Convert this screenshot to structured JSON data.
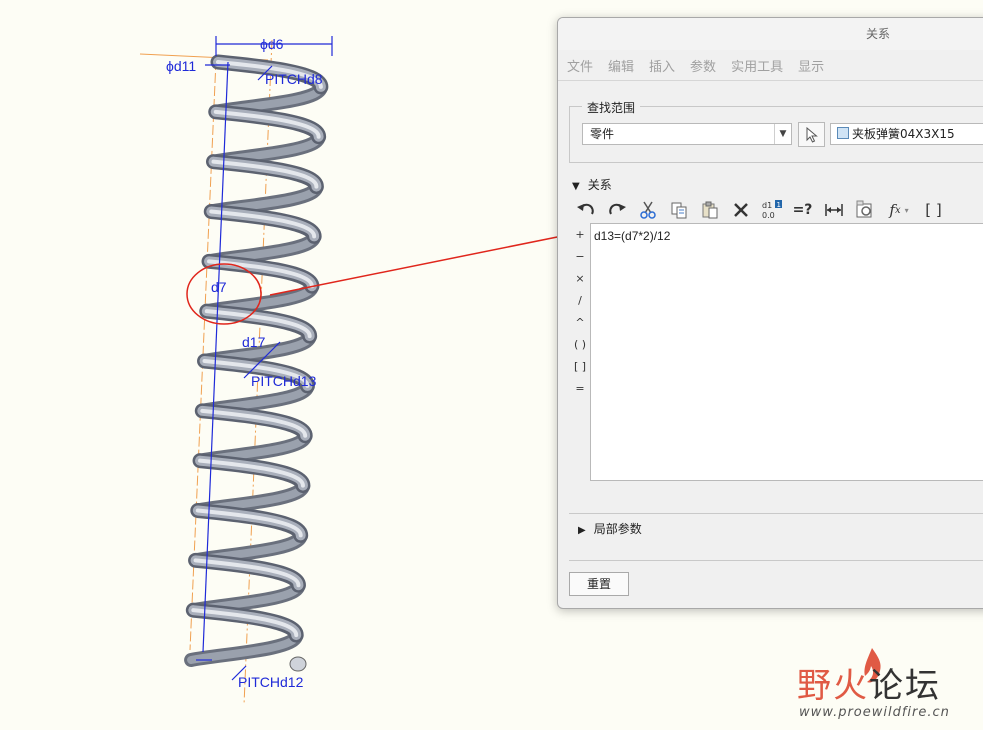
{
  "viewport": {
    "dimensions": {
      "d6": "ϕd6",
      "d11": "ϕd11",
      "pitch_d8": "PITCHd8",
      "d7": "d7",
      "d17": "d17",
      "pitch_d13": "PITCHd13",
      "pitch_d12": "PITCHd12"
    }
  },
  "dialog": {
    "title": "关系",
    "menu": [
      "文件",
      "编辑",
      "插入",
      "参数",
      "实用工具",
      "显示"
    ],
    "scope_label": "查找范围",
    "scope_value": "零件",
    "model_name": "夹板弹簧04X3X15",
    "relations_label": "关系",
    "toolbar_icons": [
      "undo-icon",
      "redo-icon",
      "cut-icon",
      "copy-icon",
      "paste-icon",
      "delete-icon",
      "switch-dims-icon",
      "evaluate-icon",
      "measure-icon",
      "insert-feature-icon",
      "function-icon",
      "bracket-icon"
    ],
    "operators": [
      "+",
      "−",
      "×",
      "/",
      "^",
      "( )",
      "[ ]",
      "="
    ],
    "relation_text": "d13=(d7*2)/12",
    "local_params_label": "局部参数",
    "reset_label": "重置"
  },
  "watermark": {
    "title_red": "野火",
    "title_dark": "论坛",
    "url": "www.proewildfire.cn"
  },
  "colors": {
    "dimension_blue": "#1f2ad8",
    "annotation_red": "#e0261c",
    "axis_orange": "#f0a050"
  }
}
